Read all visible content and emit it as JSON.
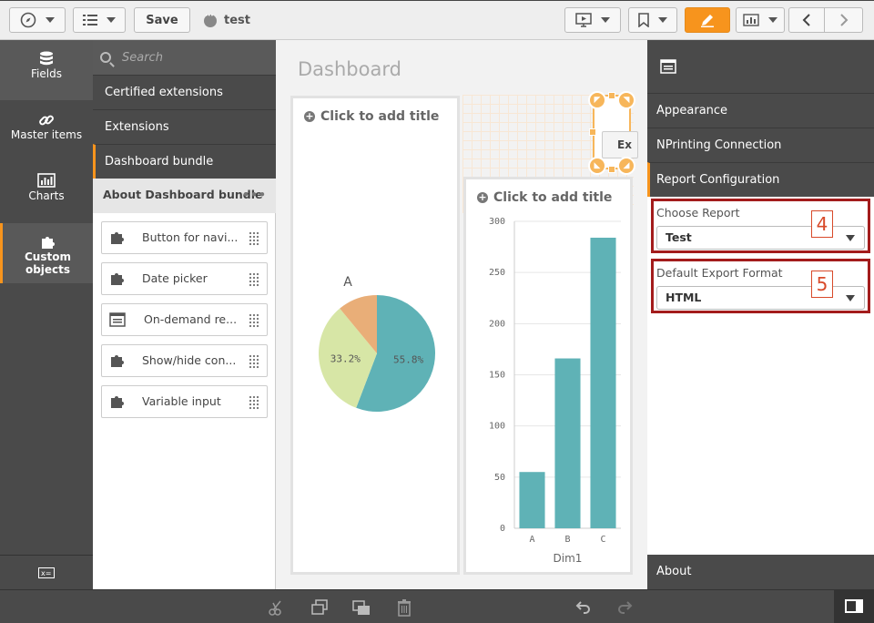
{
  "toolbar": {
    "save_label": "Save",
    "app_name": "test"
  },
  "rail": {
    "items": [
      {
        "label": "Fields",
        "icon": "database-icon"
      },
      {
        "label": "Master items",
        "icon": "link-icon"
      },
      {
        "label": "Charts",
        "icon": "bar-chart-icon"
      },
      {
        "label": "Custom objects",
        "icon": "puzzle-icon"
      }
    ]
  },
  "assets": {
    "search_placeholder": "Search",
    "categories": [
      "Certified extensions",
      "Extensions",
      "Dashboard bundle"
    ],
    "about_label": "About Dashboard bundle",
    "objects": [
      {
        "label": "Button for navi...",
        "icon": "puzzle-icon"
      },
      {
        "label": "Date picker",
        "icon": "puzzle-icon"
      },
      {
        "label": "On-demand re...",
        "icon": "report-icon"
      },
      {
        "label": "Show/hide con...",
        "icon": "puzzle-icon"
      },
      {
        "label": "Variable input",
        "icon": "puzzle-icon"
      }
    ]
  },
  "canvas": {
    "sheet_title": "Dashboard",
    "pie_card": {
      "title": "Click to add title"
    },
    "bar_card": {
      "title": "Click to add title"
    },
    "export_button_label": "Ex"
  },
  "chart_data": [
    {
      "type": "pie",
      "title": "A",
      "values": [
        55.8,
        33.2,
        11.0
      ],
      "data_labels": [
        "55.8%",
        "33.2%",
        ""
      ],
      "colors": [
        "#5fb2b6",
        "#d7e6a6",
        "#e9ae78"
      ]
    },
    {
      "type": "bar",
      "categories": [
        "A",
        "B",
        "C"
      ],
      "values": [
        55,
        166,
        284
      ],
      "xlabel": "Dim1",
      "ylabel": "",
      "ylim": [
        0,
        300
      ],
      "yticks": [
        "0",
        "50",
        "100",
        "150",
        "200",
        "250",
        "300"
      ],
      "color": "#5fb2b6",
      "grid": true
    }
  ],
  "properties": {
    "sections": [
      "Appearance",
      "NPrinting Connection",
      "Report Configuration"
    ],
    "choose_report": {
      "label": "Choose Report",
      "value": "Test",
      "callout": "4"
    },
    "export_format": {
      "label": "Default Export Format",
      "value": "HTML",
      "callout": "5"
    },
    "about_label": "About"
  },
  "colors": {
    "accent": "#f7941d",
    "panel_dark": "#4a4a4a",
    "highlight_border": "#a31c1c",
    "chart_teal": "#5fb2b6"
  }
}
